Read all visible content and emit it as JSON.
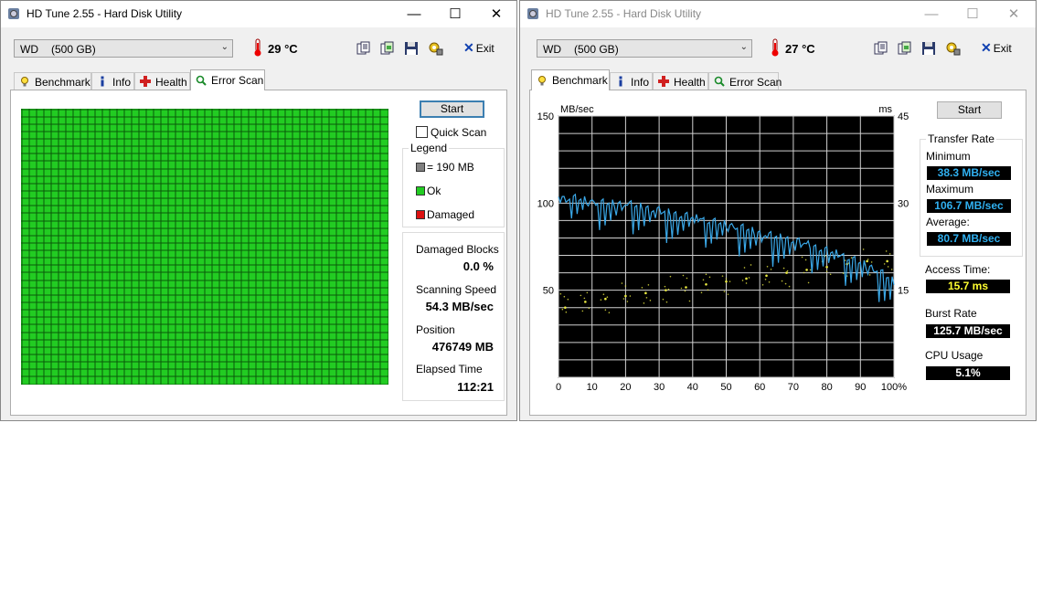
{
  "left_window": {
    "title": "HD Tune 2.55 - Hard Disk Utility",
    "drive": {
      "name": "WD",
      "capacity": "(500 GB)"
    },
    "temperature": "29 °C",
    "exit_label": "Exit",
    "tabs": [
      {
        "label": "Benchmark",
        "icon": "bulb-icon"
      },
      {
        "label": "Info",
        "icon": "info-icon"
      },
      {
        "label": "Health",
        "icon": "health-cross-icon"
      },
      {
        "label": "Error Scan",
        "icon": "magnifier-icon"
      }
    ],
    "active_tab": "Error Scan",
    "error_scan": {
      "start_label": "Start",
      "quick_scan_label": "Quick Scan",
      "quick_scan_checked": false,
      "legend_title": "Legend",
      "legend_block": "= 190 MB",
      "legend_ok": "Ok",
      "legend_damaged": "Damaged",
      "damaged_blocks_label": "Damaged Blocks",
      "damaged_blocks_value": "0.0 %",
      "scanning_speed_label": "Scanning Speed",
      "scanning_speed_value": "54.3 MB/sec",
      "position_label": "Position",
      "position_value": "476749 MB",
      "elapsed_label": "Elapsed Time",
      "elapsed_value": "112:21",
      "block_color_ok": "#22cc22",
      "block_color_damaged": "#dd1111",
      "block_color_unscanned": "#808080"
    }
  },
  "right_window": {
    "title": "HD Tune 2.55 - Hard Disk Utility",
    "drive": {
      "name": "WD",
      "capacity": "(500 GB)"
    },
    "temperature": "27 °C",
    "exit_label": "Exit",
    "tabs": [
      {
        "label": "Benchmark",
        "icon": "bulb-icon"
      },
      {
        "label": "Info",
        "icon": "info-icon"
      },
      {
        "label": "Health",
        "icon": "health-cross-icon"
      },
      {
        "label": "Error Scan",
        "icon": "magnifier-icon"
      }
    ],
    "active_tab": "Benchmark",
    "benchmark": {
      "start_label": "Start",
      "transfer_rate_title": "Transfer Rate",
      "minimum_label": "Minimum",
      "minimum_value": "38.3 MB/sec",
      "maximum_label": "Maximum",
      "maximum_value": "106.7 MB/sec",
      "average_label": "Average:",
      "average_value": "80.7 MB/sec",
      "access_time_label": "Access Time:",
      "access_time_value": "15.7 ms",
      "burst_rate_label": "Burst Rate",
      "burst_rate_value": "125.7 MB/sec",
      "cpu_usage_label": "CPU Usage",
      "cpu_usage_value": "5.1%",
      "value_color_blue": "#30b0f0",
      "value_color_yellow": "#ffff30"
    }
  },
  "chart_data": {
    "type": "line",
    "y_left_unit": "MB/sec",
    "y_right_unit": "ms",
    "y_left_range": [
      0,
      150
    ],
    "y_right_range": [
      0,
      45
    ],
    "y_left_ticks": [
      "150",
      "100",
      "50"
    ],
    "y_right_ticks": [
      "45",
      "30",
      "15"
    ],
    "x_range": [
      0,
      100
    ],
    "x_ticks": [
      "0",
      "10",
      "20",
      "30",
      "40",
      "50",
      "60",
      "70",
      "80",
      "90",
      "100%"
    ],
    "grid": true,
    "background": "#000000",
    "series": [
      {
        "color": "#3aa8e8",
        "axis": "left",
        "x": [
          0,
          5,
          10,
          15,
          20,
          25,
          30,
          35,
          40,
          45,
          50,
          55,
          60,
          65,
          70,
          75,
          80,
          85,
          90,
          95,
          100
        ],
        "values": [
          104,
          103,
          101,
          100,
          100,
          98,
          96,
          94,
          92,
          90,
          88,
          86,
          83,
          81,
          79,
          76,
          73,
          70,
          66,
          62,
          55
        ]
      },
      {
        "color": "#e8e840",
        "axis": "right",
        "kind": "scatter",
        "x": [
          2,
          8,
          14,
          20,
          26,
          32,
          38,
          44,
          50,
          56,
          62,
          68,
          74,
          80,
          86,
          92,
          98
        ],
        "values": [
          12,
          13,
          13.5,
          14,
          14.5,
          15,
          15.5,
          16,
          16.5,
          17,
          17.5,
          18,
          18.5,
          19,
          19.5,
          20,
          20
        ]
      }
    ]
  }
}
